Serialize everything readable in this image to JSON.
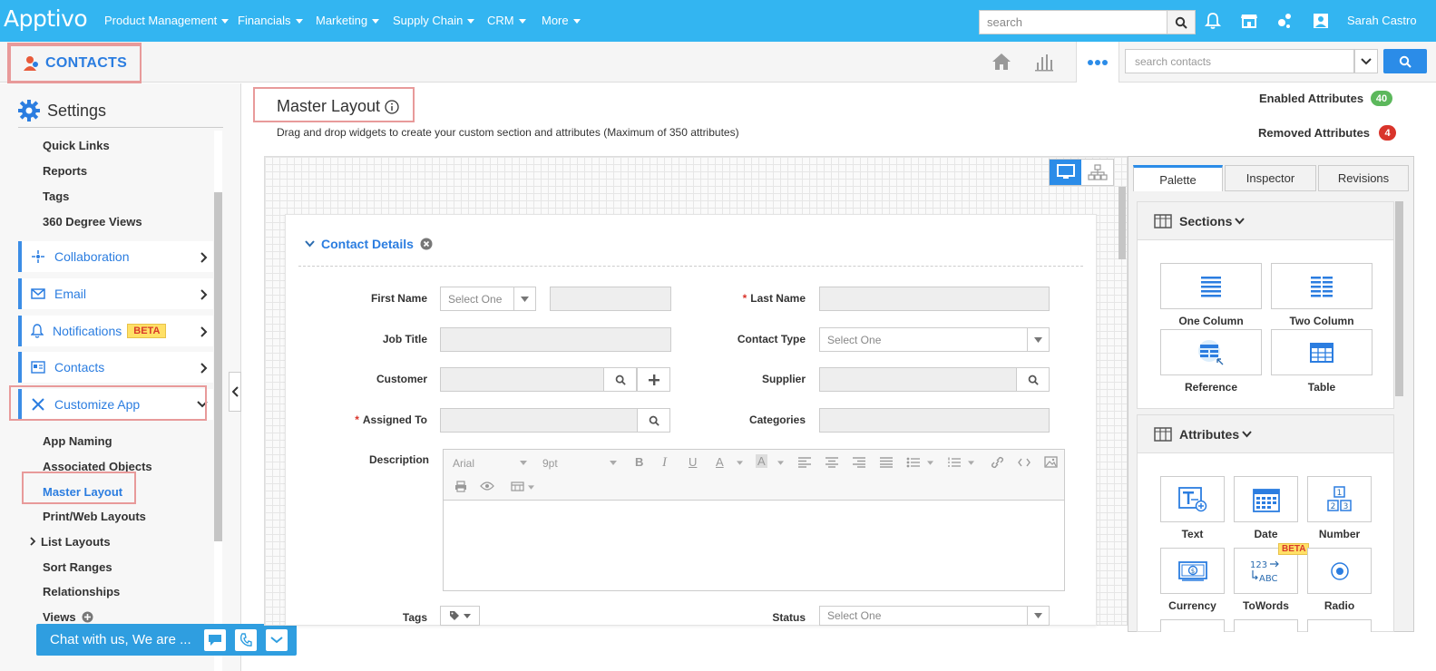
{
  "topbar": {
    "logo": "Apptivo",
    "nav": [
      {
        "label": "Product Management"
      },
      {
        "label": "Financials"
      },
      {
        "label": "Marketing"
      },
      {
        "label": "Supply Chain"
      },
      {
        "label": "CRM"
      },
      {
        "label": "More"
      }
    ],
    "search_placeholder": "search",
    "user_name": "Sarah Castro"
  },
  "appbar": {
    "app_name": "CONTACTS",
    "search_placeholder": "search contacts"
  },
  "sidebar": {
    "heading": "Settings",
    "top_links": [
      "Quick Links",
      "Reports",
      "Tags",
      "360 Degree Views"
    ],
    "groups": [
      {
        "label": "Collaboration"
      },
      {
        "label": "Email"
      },
      {
        "label": "Notifications",
        "badge": "BETA"
      },
      {
        "label": "Contacts"
      },
      {
        "label": "Customize App"
      }
    ],
    "sub_links": [
      "App Naming",
      "Associated Objects",
      "Master Layout",
      "Print/Web Layouts",
      "List Layouts",
      "Sort Ranges",
      "Relationships",
      "Views"
    ]
  },
  "chat": {
    "label": "Chat with us, We are ..."
  },
  "main": {
    "title": "Master Layout",
    "description": "Drag and drop widgets to create your custom section and attributes (Maximum of 350 attributes)",
    "enabled_label": "Enabled Attributes",
    "enabled_count": "40",
    "removed_label": "Removed Attributes",
    "removed_count": "4",
    "section_title": "Contact Details",
    "fields": {
      "first_name": "First Name",
      "first_name_select": "Select One",
      "last_name": "Last Name",
      "job_title": "Job Title",
      "contact_type": "Contact Type",
      "contact_type_select": "Select One",
      "customer": "Customer",
      "supplier": "Supplier",
      "assigned_to": "Assigned To",
      "categories": "Categories",
      "description": "Description",
      "tags": "Tags",
      "status": "Status",
      "status_select": "Select One"
    },
    "editor": {
      "font": "Arial",
      "size": "9pt"
    }
  },
  "palette": {
    "tabs": [
      "Palette",
      "Inspector",
      "Revisions"
    ],
    "sections_title": "Sections",
    "section_tiles": [
      "One Column",
      "Two Column",
      "Reference",
      "Table"
    ],
    "attributes_title": "Attributes",
    "attribute_tiles": [
      "Text",
      "Date",
      "Number",
      "Currency",
      "ToWords",
      "Radio"
    ],
    "towords_badge": "BETA"
  },
  "colors": {
    "topbar": "#33b5f1",
    "accent": "#2b7de0",
    "highlight": "#e89a9a",
    "enabled_badge": "#5cb85c",
    "removed_badge": "#d9342b"
  }
}
